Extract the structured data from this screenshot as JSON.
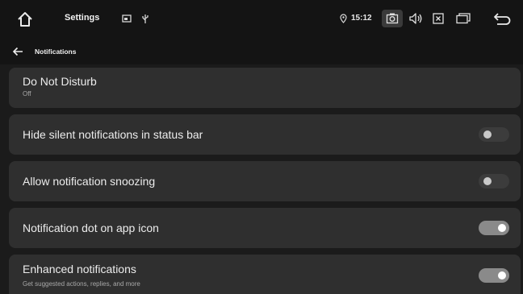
{
  "status_bar": {
    "title": "Settings",
    "time": "15:12",
    "icons": [
      "home-icon",
      "screen-icon",
      "usb-icon",
      "location-icon",
      "camera-icon",
      "volume-icon",
      "close-box-icon",
      "window-icon",
      "back-icon"
    ]
  },
  "app_bar": {
    "title": "Notifications",
    "back_icon": "arrow-back-icon"
  },
  "settings": [
    {
      "title": "Do Not Disturb",
      "subtitle": "Off",
      "toggle": null
    },
    {
      "title": "Hide silent notifications in status bar",
      "toggle": false
    },
    {
      "title": "Allow notification snoozing",
      "toggle": false
    },
    {
      "title": "Notification dot on app icon",
      "toggle": true
    },
    {
      "title": "Enhanced notifications",
      "subtitle": "Get suggested actions, replies, and more",
      "toggle": true
    }
  ],
  "colors": {
    "background": "#1b1b1b",
    "card": "#2f2f2f",
    "toggle_on_track": "#8a8a8a",
    "toggle_off_track": "#3c3c3c"
  }
}
